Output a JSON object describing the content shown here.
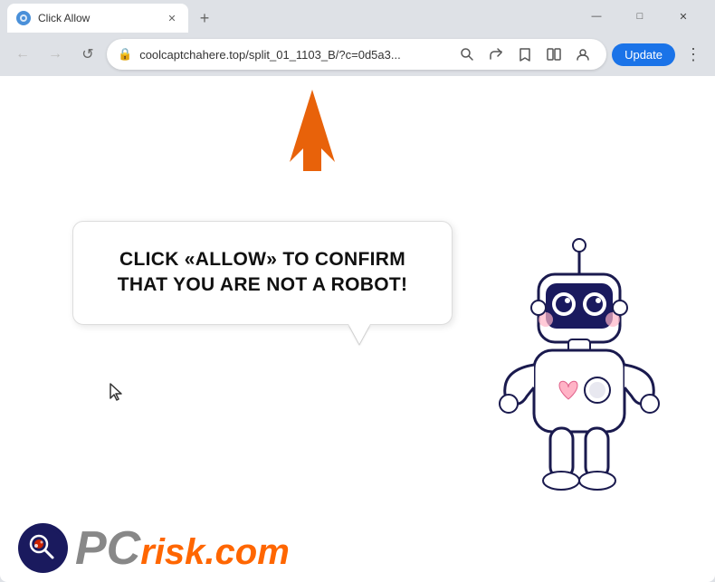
{
  "window": {
    "title": "Click Allow",
    "url": "coolcaptchahere.top/split_01_1103_B/?c=0d5a3...",
    "tab_title": "Click Allow",
    "new_tab_label": "+",
    "update_btn_label": "Update"
  },
  "nav": {
    "back_label": "←",
    "forward_label": "→",
    "refresh_label": "↺"
  },
  "bubble": {
    "text": "CLICK «ALLOW» TO CONFIRM THAT YOU ARE NOT A ROBOT!"
  },
  "logo": {
    "text_gray": "PC",
    "text_orange": "risk.com"
  },
  "window_controls": {
    "minimize": "—",
    "maximize": "□",
    "close": "✕"
  }
}
